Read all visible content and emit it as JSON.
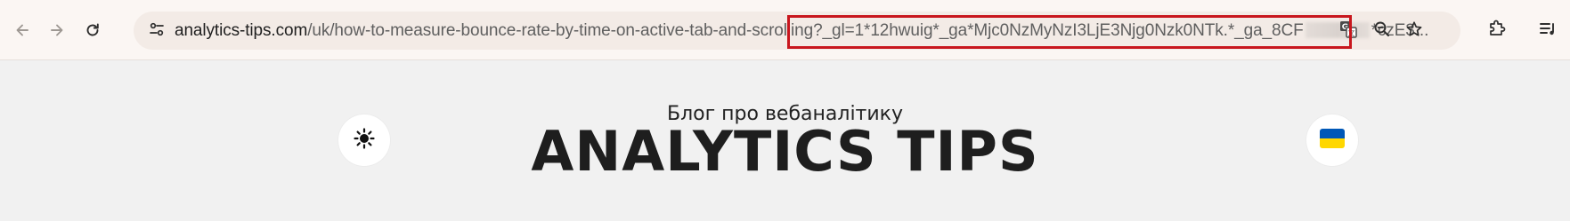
{
  "browser": {
    "url": {
      "domain": "analytics-tips.com",
      "path": "/uk/how-to-measure-bounce-rate-by-time-on-active-tab-and-scrolling",
      "query_start": "?_gl=1*12hwuig*_ga*Mjc0NzMyNzI3LjE3Njg0Nzk0NTk.*_ga_8CF",
      "query_end": "*czE3..."
    },
    "icons": {
      "back": "back-arrow-icon",
      "forward": "forward-arrow-icon",
      "reload": "reload-icon",
      "site_info": "tune-icon",
      "translate": "translate-icon",
      "zoom": "zoom-out-icon",
      "bookmark": "star-icon",
      "extensions": "puzzle-icon",
      "reading_list": "reading-list-icon"
    },
    "highlight_color": "#c8161d"
  },
  "page": {
    "tagline": "Блог про вебаналітику",
    "title": "ANALYTICS TIPS",
    "theme_icon": "sun-icon",
    "language_icon": "ukraine-flag-icon",
    "flag_colors": {
      "top": "#0057b7",
      "bottom": "#ffd700"
    }
  }
}
